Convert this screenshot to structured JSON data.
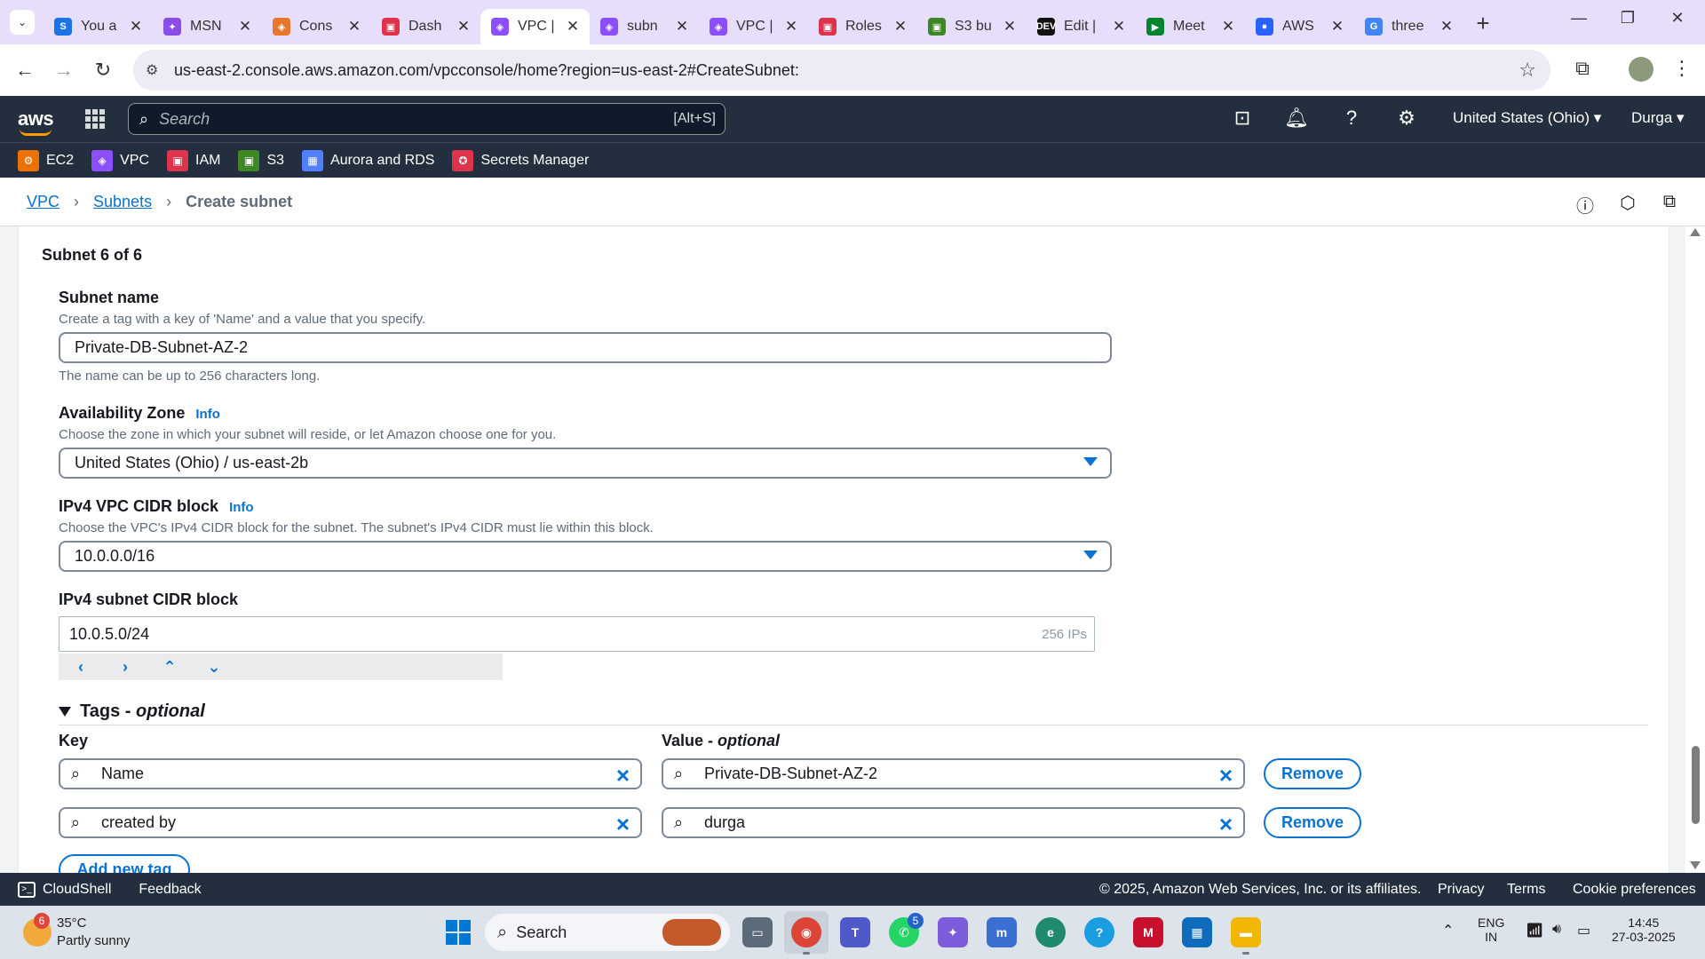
{
  "browser": {
    "tabs": [
      {
        "title": "You a",
        "icon": "s-icon",
        "color": "#1a73e8",
        "glyph": "S"
      },
      {
        "title": "MSN",
        "icon": "msn-icon",
        "color": "#8a4de8",
        "glyph": "✦"
      },
      {
        "title": "Cons",
        "icon": "aws-console-icon",
        "color": "#e8762d",
        "glyph": "◈"
      },
      {
        "title": "Dash",
        "icon": "iam-icon",
        "color": "#dd344c",
        "glyph": "▣"
      },
      {
        "title": "VPC |",
        "icon": "vpc-icon",
        "color": "#8c4fff",
        "glyph": "◈",
        "active": true
      },
      {
        "title": "subn",
        "icon": "vpc-icon",
        "color": "#8c4fff",
        "glyph": "◈"
      },
      {
        "title": "VPC |",
        "icon": "vpc-icon",
        "color": "#8c4fff",
        "glyph": "◈"
      },
      {
        "title": "Roles",
        "icon": "iam-icon",
        "color": "#dd344c",
        "glyph": "▣"
      },
      {
        "title": "S3 bu",
        "icon": "s3-icon",
        "color": "#3f8624",
        "glyph": "▣"
      },
      {
        "title": "Edit |",
        "icon": "dev-icon",
        "color": "#111111",
        "glyph": "DEV"
      },
      {
        "title": "Meet",
        "icon": "meet-icon",
        "color": "#00832d",
        "glyph": "▶"
      },
      {
        "title": "AWS",
        "icon": "aws-chat-icon",
        "color": "#2962ff",
        "glyph": "●"
      },
      {
        "title": "three",
        "icon": "google-icon",
        "color": "#4285f4",
        "glyph": "G"
      }
    ],
    "url": "us-east-2.console.aws.amazon.com/vpcconsole/home?region=us-east-2#CreateSubnet:"
  },
  "aws_nav": {
    "logo": "aws",
    "search_placeholder": "Search",
    "search_shortcut": "[Alt+S]",
    "region": "United States (Ohio) ▾",
    "user": "Durga ▾"
  },
  "favorites": [
    {
      "label": "EC2",
      "color": "#ed7100",
      "glyph": "⚙"
    },
    {
      "label": "VPC",
      "color": "#8c4fff",
      "glyph": "◈"
    },
    {
      "label": "IAM",
      "color": "#dd344c",
      "glyph": "▣"
    },
    {
      "label": "S3",
      "color": "#3f8624",
      "glyph": "▣"
    },
    {
      "label": "Aurora and RDS",
      "color": "#527fff",
      "glyph": "▦"
    },
    {
      "label": "Secrets Manager",
      "color": "#dd344c",
      "glyph": "✪"
    }
  ],
  "breadcrumb": {
    "vpc": "VPC",
    "subnets": "Subnets",
    "current": "Create subnet"
  },
  "form": {
    "section_title": "Subnet 6 of 6",
    "subnet_name": {
      "label": "Subnet name",
      "description": "Create a tag with a key of 'Name' and a value that you specify.",
      "value": "Private-DB-Subnet-AZ-2",
      "hint": "The name can be up to 256 characters long."
    },
    "az": {
      "label": "Availability Zone",
      "info": "Info",
      "description": "Choose the zone in which your subnet will reside, or let Amazon choose one for you.",
      "value": "United States (Ohio) / us-east-2b"
    },
    "vpc_cidr": {
      "label": "IPv4 VPC CIDR block",
      "info": "Info",
      "description": "Choose the VPC's IPv4 CIDR block for the subnet. The subnet's IPv4 CIDR must lie within this block.",
      "value": "10.0.0.0/16"
    },
    "subnet_cidr": {
      "label": "IPv4 subnet CIDR block",
      "value": "10.0.5.0/24",
      "ip_count": "256 IPs",
      "controls": [
        "‹",
        "›",
        "⌃",
        "⌄"
      ]
    },
    "tags": {
      "heading": "Tags - ",
      "heading_optional": "optional",
      "key_label": "Key",
      "value_label": "Value - ",
      "value_optional": "optional",
      "rows": [
        {
          "key": "Name",
          "value": "Private-DB-Subnet-AZ-2",
          "remove": "Remove"
        },
        {
          "key": "created by",
          "value": "durga",
          "remove": "Remove"
        }
      ],
      "add_new": "Add new tag"
    }
  },
  "footer": {
    "cloudshell": "CloudShell",
    "feedback": "Feedback",
    "copyright": "© 2025, Amazon Web Services, Inc. or its affiliates.",
    "privacy": "Privacy",
    "terms": "Terms",
    "cookies": "Cookie preferences"
  },
  "taskbar": {
    "weather_badge": "6",
    "temperature": "35°C",
    "condition": "Partly sunny",
    "search": "Search",
    "teams_badge": "5",
    "lang_top": "ENG",
    "lang_bottom": "IN",
    "time": "14:45",
    "date": "27-03-2025"
  },
  "colors": {
    "aws_dark": "#232f3e",
    "link_blue": "#0972d3",
    "tab_strip": "#e6defa"
  }
}
